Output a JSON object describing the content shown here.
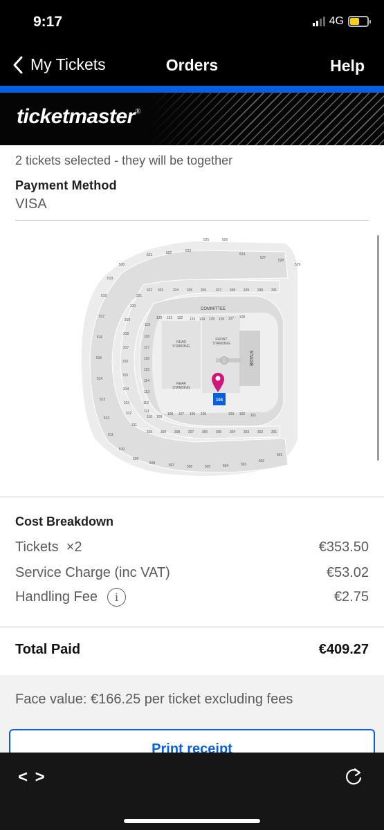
{
  "status_bar": {
    "time": "9:17",
    "network": "4G",
    "battery_color": "#f7d117"
  },
  "nav": {
    "back_label": "My Tickets",
    "title": "Orders",
    "help_label": "Help"
  },
  "brand": {
    "logo_text": "ticketmaster",
    "logo_mark": "®",
    "accent": "#0a5fdc"
  },
  "order": {
    "summary": "2 tickets selected - they will be together",
    "payment_method_label": "Payment Method",
    "payment_method_value": "VISA"
  },
  "seat_map": {
    "areas": {
      "stage": "STAGE",
      "front": "FRONT",
      "standing": "STANDING",
      "rear": "REAR",
      "committee": "COMMITTEE"
    },
    "selected_section": "104",
    "sections": {
      "upper_top": [
        "525",
        "526",
        "521",
        "522",
        "523",
        "524",
        "527",
        "528",
        "529",
        "520",
        "519"
      ],
      "upper_left": [
        "518",
        "517",
        "516",
        "515",
        "514",
        "513",
        "512",
        "511"
      ],
      "upper_bottom": [
        "510",
        "509",
        "508",
        "507",
        "506",
        "505",
        "504",
        "503",
        "502",
        "501"
      ],
      "tier3_top": [
        "322",
        "323",
        "324",
        "325",
        "326",
        "327",
        "328",
        "329",
        "330",
        "331",
        "321",
        "320"
      ],
      "tier3_left": [
        "319",
        "318",
        "317",
        "316",
        "315",
        "314",
        "313",
        "312",
        "311"
      ],
      "tier3_bottom": [
        "310",
        "309",
        "308",
        "307",
        "306",
        "305",
        "304",
        "303",
        "302",
        "301"
      ],
      "lower_top": [
        "120",
        "121",
        "122",
        "123",
        "124",
        "125",
        "126",
        "127",
        "128",
        "119"
      ],
      "lower_left": [
        "118",
        "117",
        "116",
        "115",
        "114",
        "113",
        "112",
        "111",
        "110"
      ],
      "lower_bottom": [
        "109",
        "108",
        "107",
        "106",
        "105",
        "104",
        "103",
        "102",
        "101"
      ]
    },
    "colors": {
      "section": "#dcdcdc",
      "background": "#ececec",
      "selected": "#0a5fdc",
      "pin": "#d0157a"
    }
  },
  "cost_breakdown": {
    "title": "Cost Breakdown",
    "rows": [
      {
        "label": "Tickets",
        "qty": "×2",
        "amount": "€353.50"
      },
      {
        "label": "Service Charge (inc VAT)",
        "amount": "€53.02"
      },
      {
        "label": "Handling Fee",
        "amount": "€2.75"
      }
    ],
    "total_label": "Total Paid",
    "total_amount": "€409.27"
  },
  "face_value": "Face value: €166.25 per ticket excluding fees",
  "print_button": "Print receipt",
  "browser_toolbar": {
    "code_icon": "< >"
  }
}
